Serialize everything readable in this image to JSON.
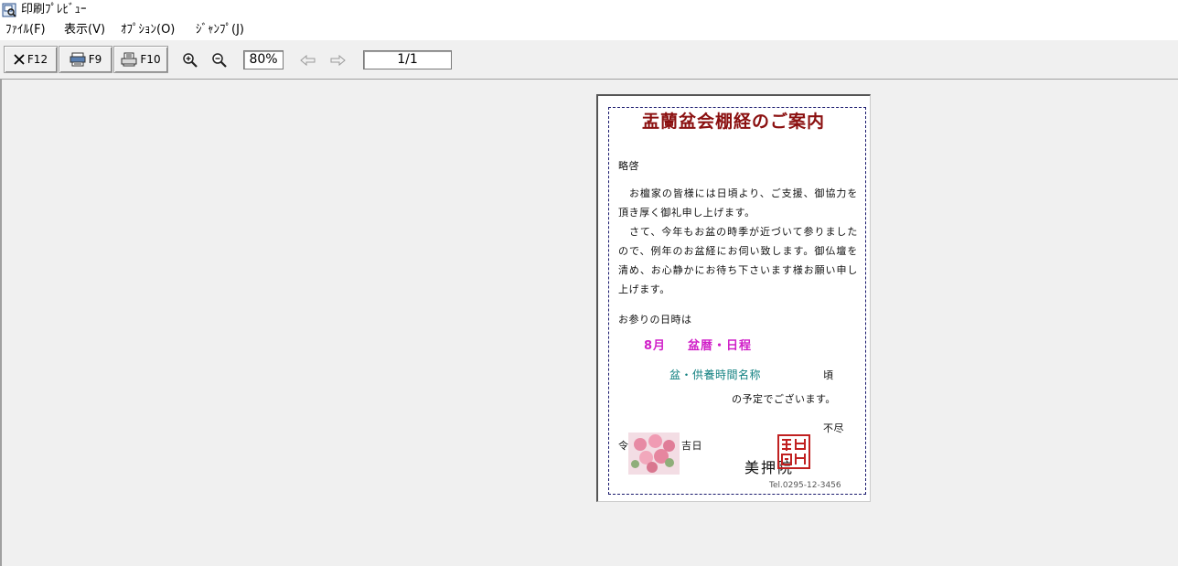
{
  "window": {
    "title": "印刷ﾌﾟﾚﾋﾞｭｰ"
  },
  "menu": [
    {
      "label": "ﾌｧｲﾙ(F)"
    },
    {
      "label": "表示(V)"
    },
    {
      "label": "ｵﾌﾟｼｮﾝ(O)"
    },
    {
      "label": "ｼﾞｬﾝﾌﾟ(J)"
    }
  ],
  "toolbar": {
    "close_label": "F12",
    "close_icon": "close-x-icon",
    "printer_setup_label": "F9",
    "printer_setup_icon": "printer-setup-icon",
    "print_label": "F10",
    "print_icon": "printer-icon",
    "zoom_in_icon": "zoom-in-icon",
    "zoom_out_icon": "zoom-out-icon",
    "zoom_value": "80%",
    "prev_page_icon": "arrow-left-icon",
    "next_page_icon": "arrow-right-icon",
    "page_indicator": "1/1"
  },
  "document": {
    "title": "盂蘭盆会棚経のご案内",
    "greeting": "略啓",
    "paragraph1": "　お檀家の皆様には日頃より、ご支援、御協力を頂き厚く御礼申し上げます。",
    "paragraph2": "　さて、今年もお盆の時季が近づいて参りましたので、例年のお盆経にお伺い致します。御仏壇を清め、お心静かにお待ち下さいます様お願い申し上げます。",
    "visit_label": "お参りの日時は",
    "month": "8月",
    "schedule": "盆暦・日程",
    "service_label": "盆・供養時間名称",
    "approx": "頃",
    "planned": "の予定でございます。",
    "closing": "不尽",
    "date": "令和6年 7月 吉日",
    "temple_name": "美押院",
    "tel": "Tel.0295-12-3456",
    "colors": {
      "title": "#8b1010",
      "schedule": "#d020c8",
      "service": "#108080",
      "frame": "#1a1a6e"
    }
  }
}
